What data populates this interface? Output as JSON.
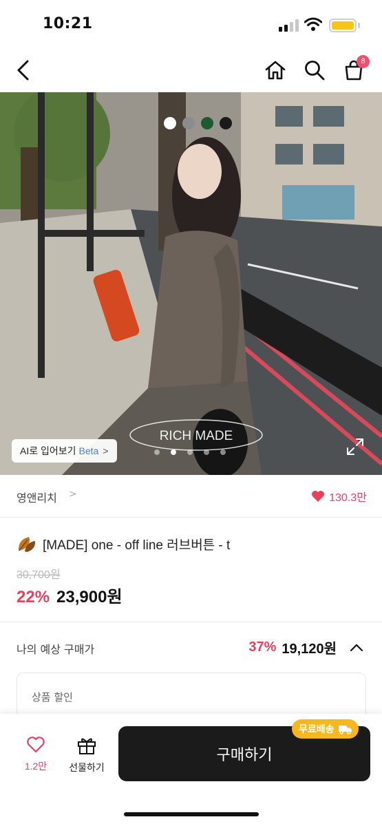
{
  "status_bar": {
    "time": "10:21"
  },
  "nav": {
    "cart_count": "8",
    "icons": [
      "back-arrow-icon",
      "home-icon",
      "search-icon",
      "shopping-bag-icon"
    ]
  },
  "hero": {
    "color_options": [
      "#ffffff",
      "#8c8c8c",
      "#1e5a30",
      "#1a1a1a"
    ],
    "watermark_text": "RICH MADE",
    "ai_fit": {
      "label": "AI로 입어보기",
      "beta": "Beta",
      "chevron": ">"
    },
    "page_dots": 5,
    "active_page": 2
  },
  "brand": {
    "name": "영앤리치",
    "chevron": ">",
    "likes": "130.3만"
  },
  "product": {
    "title": "[MADE] one - off line 러브버튼  - t",
    "original_price": "30,700원",
    "discount_rate": "22%",
    "sale_price": "23,900원"
  },
  "expected_price": {
    "label": "나의 예상 구매가",
    "discount_rate": "37%",
    "price": "19,120원",
    "chevron": "^"
  },
  "discount_box": {
    "label": "상품 할인"
  },
  "bottom_bar": {
    "wish_count": "1.2만",
    "gift_label": "선물하기",
    "buy_label": "구매하기",
    "free_shipping": "무료배송"
  },
  "colors": {
    "accent": "#e8405f",
    "buy_button": "#1b1b1b",
    "free_shipping": "#f6b81e"
  }
}
